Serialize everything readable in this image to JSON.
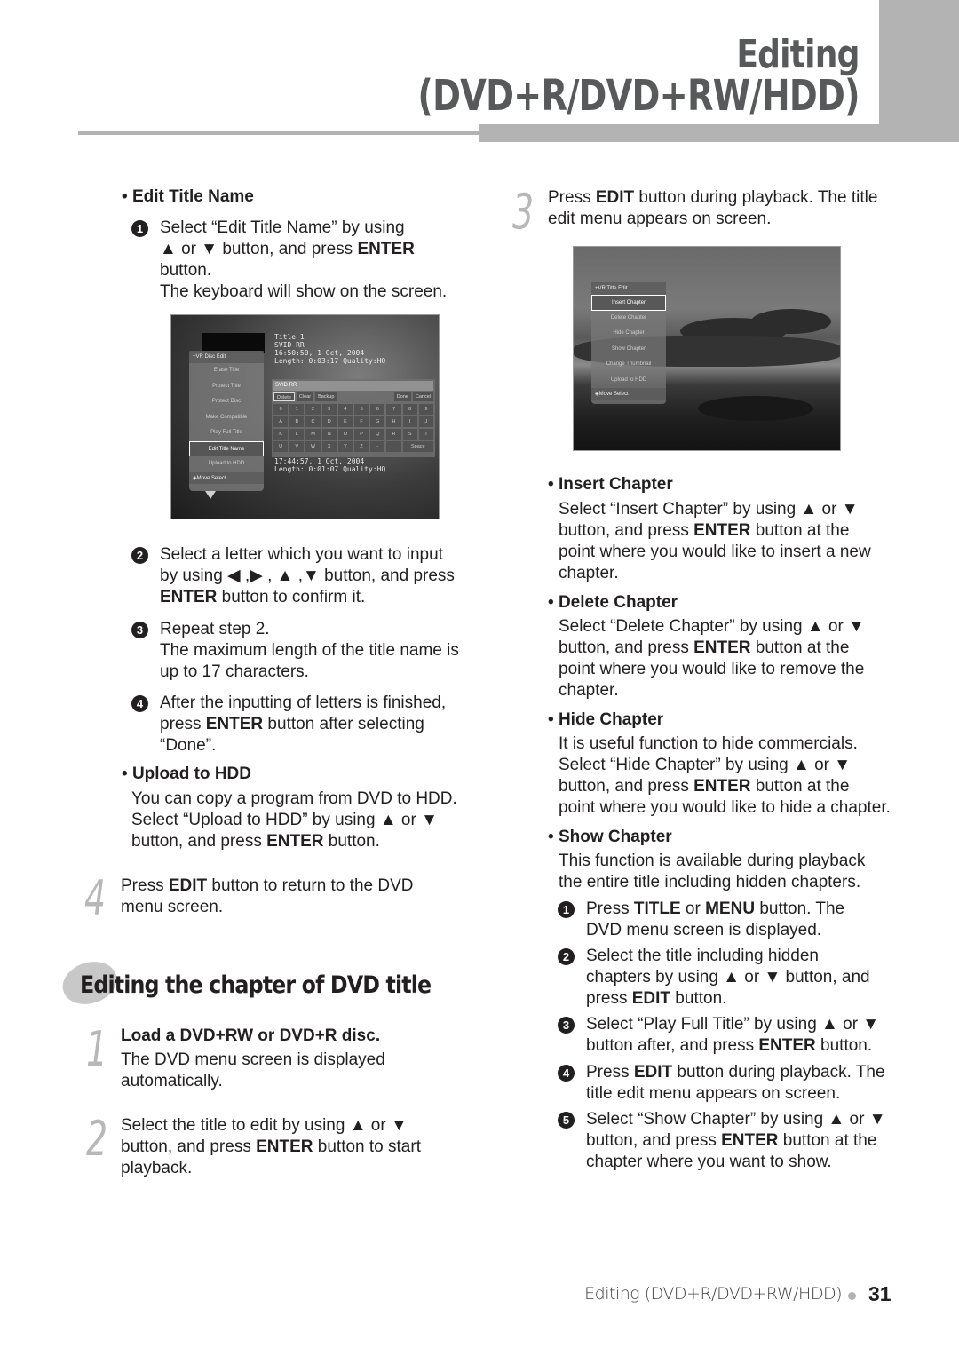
{
  "header": {
    "title_line1": "Editing",
    "title_line2": "(DVD+R/DVD+RW/HDD)",
    "accent_color": "#b3b3b3",
    "title_color": "#58595b"
  },
  "left": {
    "edit_title_name": {
      "heading": "Edit Title Name",
      "steps": [
        {
          "num": "1",
          "lines": [
            "Select “Edit Title Name” by using",
            "▲ or ▼ button, and press ",
            "ENTER",
            "button.",
            "The keyboard will show on the screen."
          ]
        },
        {
          "num": "2",
          "text_a": "Select a letter which you want to input",
          "text_b": "by using ◀ ,▶ , ▲ ,▼  button, and press",
          "bold": "ENTER",
          "text_c": " button to confirm it."
        },
        {
          "num": "3",
          "text_a": "Repeat step 2.",
          "text_b": "The maximum length of the title name is",
          "text_c": "up to 17 characters."
        },
        {
          "num": "4",
          "text_a": "After the inputting of letters is finished,",
          "text_b_pre": "press ",
          "bold": "ENTER",
          "text_b_post": " button after selecting",
          "text_c": "“Done”."
        }
      ]
    },
    "upload_to_hdd": {
      "heading": "Upload to HDD",
      "line1": "You can copy a program from DVD to HDD.",
      "line2": "Select “Upload to HDD” by using  ▲ or ▼",
      "line3_pre": "button, and press ",
      "bold": "ENTER",
      "line3_post": " button."
    },
    "step4": {
      "num": "4",
      "pre": "Press ",
      "bold": "EDIT",
      "post": " button to return to the DVD",
      "line2": "menu screen."
    },
    "section_title": "Editing the chapter of DVD title",
    "step1": {
      "num": "1",
      "heading": "Load a DVD+RW or DVD+R disc.",
      "line1": "The DVD menu screen is displayed",
      "line2": "automatically."
    },
    "step2": {
      "num": "2",
      "line1": "Select the title to edit by using ▲ or ▼",
      "line2_pre": "button, and press ",
      "bold": "ENTER",
      "line2_post": " button to start",
      "line3": "playback."
    }
  },
  "screenshot1": {
    "info_top": [
      "Title 1",
      " SVID RR",
      "16:50:50, 1 Oct, 2004",
      "Length:  0:03:17 Quality:HQ"
    ],
    "info_bottom": [
      "17:44:57, 1 Oct, 2004",
      "Length:  0:01:07 Quality:HQ"
    ],
    "menu_header": "+VR Disc Edit",
    "menu_items": [
      "Erase Title",
      "Protect Title",
      "Protect Disc",
      "Make Compatible",
      "Play Full Title",
      "Edit Title Name",
      "Upload to HDD"
    ],
    "selected_item": "Edit Title Name",
    "menu_footer": "◈Move Select",
    "kb_field": "SVID RR",
    "kb_buttons": [
      "Delete",
      "Clear",
      "Backup",
      "Done",
      "Cancel"
    ],
    "kb_keys": [
      "0",
      "1",
      "2",
      "3",
      "4",
      "5",
      "6",
      "7",
      "8",
      "9",
      "A",
      "B",
      "C",
      "D",
      "E",
      "F",
      "G",
      "H",
      "I",
      "J",
      "K",
      "L",
      "M",
      "N",
      "O",
      "P",
      "Q",
      "R",
      "S",
      "T",
      "U",
      "V",
      "W",
      "X",
      "Y",
      "Z",
      "-",
      "_",
      "Space"
    ]
  },
  "right": {
    "step3": {
      "num": "3",
      "pre": "Press ",
      "bold": "EDIT",
      "post": " button during playback. The title",
      "line2": "edit menu appears on screen."
    },
    "insert_chapter": {
      "heading": "Insert Chapter",
      "line1": "Select “Insert Chapter” by using ▲ or ▼",
      "line2_pre": "button, and press ",
      "bold": "ENTER",
      "line2_post": " button at the",
      "line3": "point where you would like to insert a new",
      "line4": "chapter."
    },
    "delete_chapter": {
      "heading": "Delete Chapter",
      "line1": "Select “Delete Chapter” by using ▲ or ▼",
      "line2_pre": "button, and press ",
      "bold": "ENTER",
      "line2_post": " button at the",
      "line3": "point where you would like to remove the",
      "line4": "chapter."
    },
    "hide_chapter": {
      "heading": "Hide Chapter",
      "line1": "It is useful function to hide commercials.",
      "line2": "Select “Hide Chapter” by using ▲ or ▼",
      "line3_pre": "button, and press ",
      "bold": "ENTER",
      "line3_post": " button at the",
      "line4": "point where you would like to hide a chapter."
    },
    "show_chapter": {
      "heading": "Show Chapter",
      "line1": "This function is available during playback",
      "line2": "the entire title including hidden chapters.",
      "steps": [
        {
          "num": "1",
          "l1_pre": "Press ",
          "b1": "TITLE",
          "l1_mid": " or ",
          "b2": "MENU",
          "l1_post": " button. The",
          "l2": "DVD menu screen is displayed."
        },
        {
          "num": "2",
          "l1": "Select the title including hidden",
          "l2": "chapters by using ▲ or ▼ button, and",
          "l3_pre": "press ",
          "bold": "EDIT",
          "l3_post": " button."
        },
        {
          "num": "3",
          "l1": "Select “Play Full Title” by using ▲ or ▼",
          "l2_pre": "button after, and press ",
          "bold": "ENTER",
          "l2_post": " button."
        },
        {
          "num": "4",
          "l1_pre": "Press ",
          "bold": "EDIT",
          "l1_post": " button during playback. The",
          "l2": "title edit menu appears on screen."
        },
        {
          "num": "5",
          "l1": "Select “Show Chapter” by using  ▲ or ▼",
          "l2_pre": "button, and press ",
          "bold": "ENTER",
          "l2_post": " button at the",
          "l3": "chapter where you want to show."
        }
      ]
    }
  },
  "screenshot2": {
    "menu_header": "+VR Title Edit",
    "menu_items": [
      "Insert Chapter",
      "Delete Chapter",
      "Hide Chapter",
      "Show Chapter",
      "Change Thumbnail",
      "Upload to HDD"
    ],
    "selected_item": "Insert Chapter",
    "menu_footer": "◈Move Select"
  },
  "footer": {
    "label": "Editing (DVD+R/DVD+RW/HDD)",
    "page_number": "31"
  }
}
